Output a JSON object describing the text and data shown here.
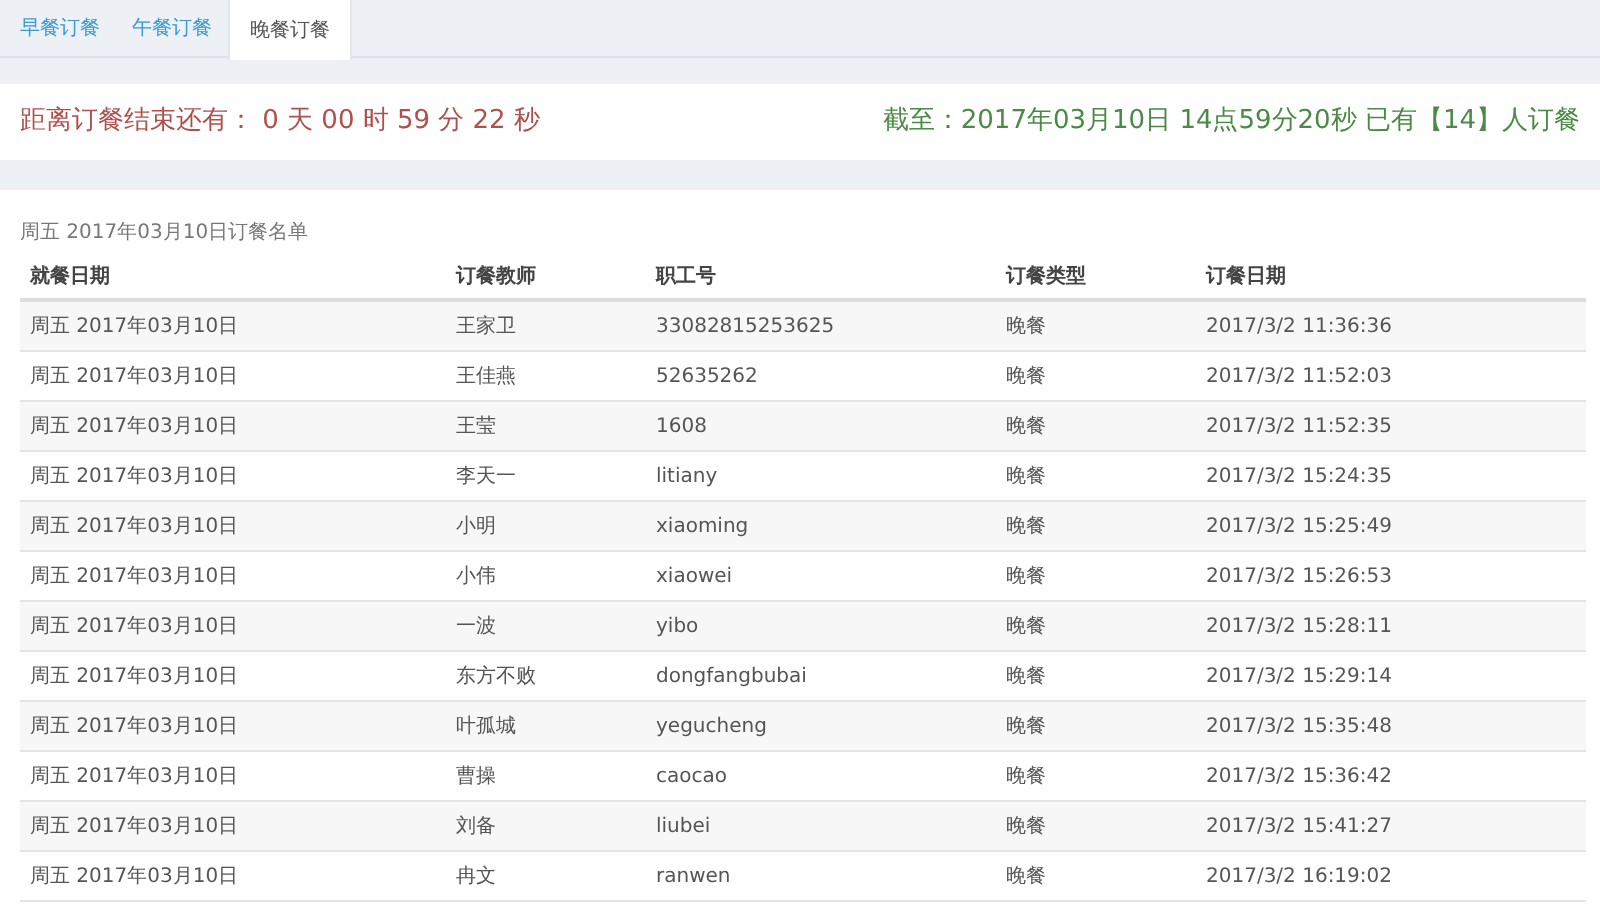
{
  "tabs": [
    {
      "label": "早餐订餐",
      "selected": false
    },
    {
      "label": "午餐订餐",
      "selected": false
    },
    {
      "label": "晚餐订餐",
      "selected": true
    }
  ],
  "countdown": "距离订餐结束还有： 0 天 00 时 59 分 22 秒",
  "order_status": "截至：2017年03月10日 14点59分20秒 已有【14】人订餐",
  "table": {
    "caption": "周五 2017年03月10日订餐名单",
    "columns": [
      "就餐日期",
      "订餐教师",
      "职工号",
      "订餐类型",
      "订餐日期"
    ],
    "rows": [
      [
        "周五 2017年03月10日",
        "王家卫",
        "33082815253625",
        "晚餐",
        "2017/3/2 11:36:36"
      ],
      [
        "周五 2017年03月10日",
        "王佳燕",
        "52635262",
        "晚餐",
        "2017/3/2 11:52:03"
      ],
      [
        "周五 2017年03月10日",
        "王莹",
        "1608",
        "晚餐",
        "2017/3/2 11:52:35"
      ],
      [
        "周五 2017年03月10日",
        "李天一",
        "litiany",
        "晚餐",
        "2017/3/2 15:24:35"
      ],
      [
        "周五 2017年03月10日",
        "小明",
        "xiaoming",
        "晚餐",
        "2017/3/2 15:25:49"
      ],
      [
        "周五 2017年03月10日",
        "小伟",
        "xiaowei",
        "晚餐",
        "2017/3/2 15:26:53"
      ],
      [
        "周五 2017年03月10日",
        "一波",
        "yibo",
        "晚餐",
        "2017/3/2 15:28:11"
      ],
      [
        "周五 2017年03月10日",
        "东方不败",
        "dongfangbubai",
        "晚餐",
        "2017/3/2 15:29:14"
      ],
      [
        "周五 2017年03月10日",
        "叶孤城",
        "yegucheng",
        "晚餐",
        "2017/3/2 15:35:48"
      ],
      [
        "周五 2017年03月10日",
        "曹操",
        "caocao",
        "晚餐",
        "2017/3/2 15:36:42"
      ],
      [
        "周五 2017年03月10日",
        "刘备",
        "liubei",
        "晚餐",
        "2017/3/2 15:41:27"
      ],
      [
        "周五 2017年03月10日",
        "冉文",
        "ranwen",
        "晚餐",
        "2017/3/2 16:19:02"
      ]
    ]
  }
}
